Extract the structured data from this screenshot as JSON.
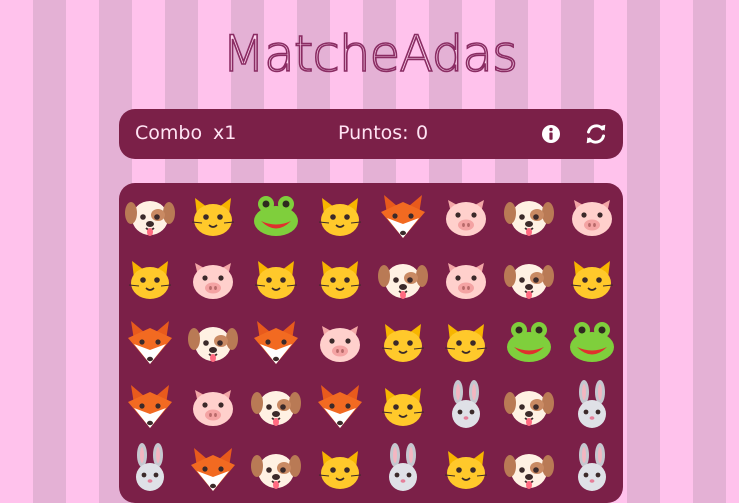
{
  "title": "MatcheAdas",
  "header": {
    "combo_label": "Combo",
    "combo_value": "x1",
    "points_label": "Puntos:",
    "points_value": "0",
    "info_icon": "info-icon",
    "refresh_icon": "refresh-icon"
  },
  "colors": {
    "background_stripe_light": "#ffc2ec",
    "background_stripe_dark": "#e4b1d5",
    "panel": "#7b2048",
    "text": "#ffe3f3"
  },
  "board": {
    "columns": 8,
    "rows": [
      [
        "dog",
        "cat",
        "frog",
        "cat",
        "fox",
        "pig",
        "dog",
        "pig"
      ],
      [
        "cat",
        "pig",
        "cat",
        "cat",
        "dog",
        "pig",
        "dog",
        "cat"
      ],
      [
        "fox",
        "dog",
        "fox",
        "pig",
        "cat",
        "cat",
        "frog",
        "frog"
      ],
      [
        "fox",
        "pig",
        "dog",
        "fox",
        "cat",
        "rabbit",
        "dog",
        "rabbit"
      ],
      [
        "rabbit",
        "fox",
        "dog",
        "cat",
        "rabbit",
        "cat",
        "dog",
        "rabbit"
      ]
    ]
  }
}
